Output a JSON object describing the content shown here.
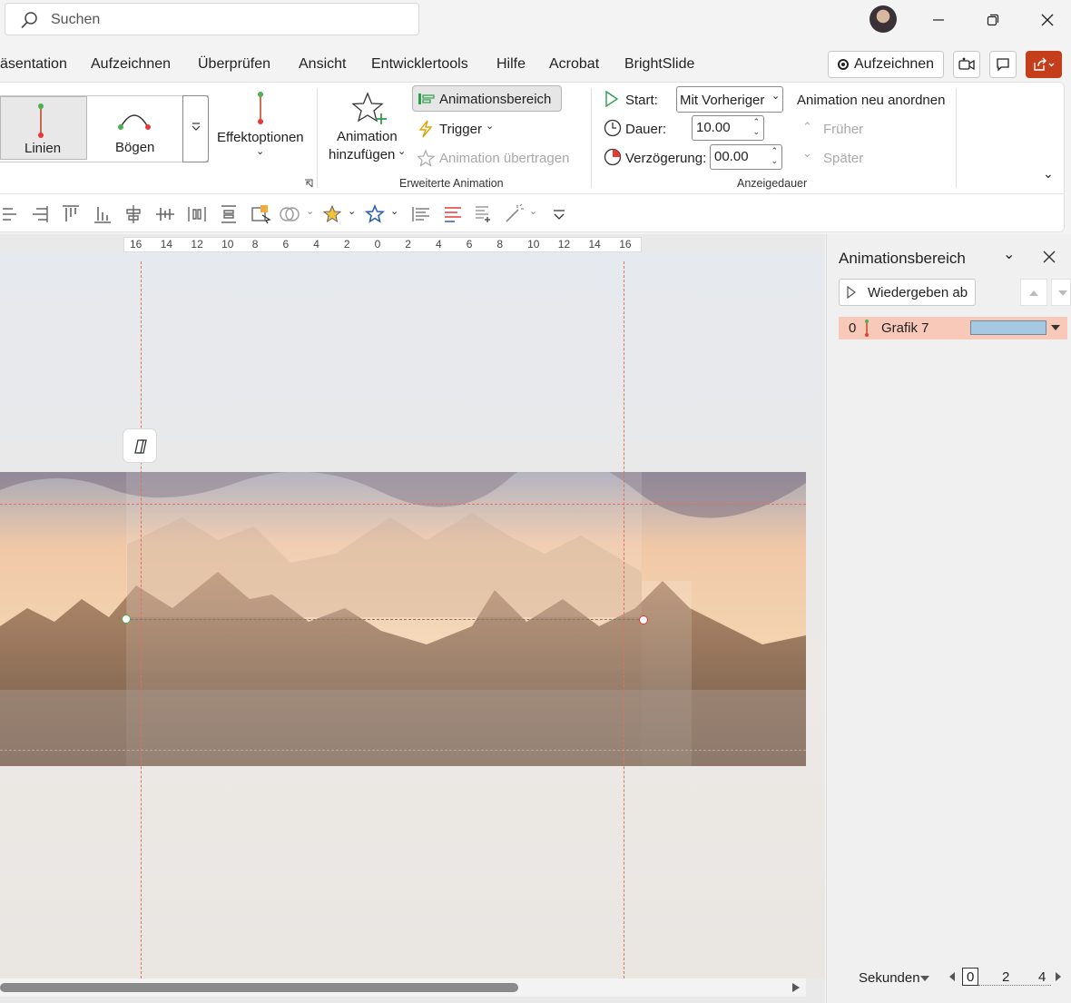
{
  "search": {
    "placeholder": "Suchen"
  },
  "tabs": [
    "äsentation",
    "Aufzeichnen",
    "Überprüfen",
    "Ansicht",
    "Entwicklertools",
    "Hilfe",
    "Acrobat",
    "BrightSlide"
  ],
  "top_buttons": {
    "record": "Aufzeichnen"
  },
  "ribbon": {
    "effects": {
      "lines": "Linien",
      "arcs": "Bögen"
    },
    "effect_options": "Effektoptionen",
    "add_animation": {
      "line1": "Animation",
      "line2": "hinzufügen"
    },
    "animation_pane_btn": "Animationsbereich",
    "trigger": "Trigger",
    "animation_painter": "Animation übertragen",
    "group_advanced": "Erweiterte Animation",
    "start_label": "Start:",
    "start_value": "Mit Vorheriger",
    "duration_label": "Dauer:",
    "duration_value": "10.00",
    "delay_label": "Verzögerung:",
    "delay_value": "00.00",
    "group_timing": "Anzeigedauer",
    "reorder_title": "Animation neu anordnen",
    "earlier": "Früher",
    "later": "Später"
  },
  "ruler_labels": [
    "16",
    "14",
    "12",
    "10",
    "8",
    "6",
    "4",
    "2",
    "0",
    "2",
    "4",
    "6",
    "8",
    "10",
    "12",
    "14",
    "16"
  ],
  "pane": {
    "title": "Animationsbereich",
    "play_from": "Wiedergeben ab",
    "item": {
      "index": "0",
      "name": "Grafik 7",
      "timeline_color": "#a6c8e0"
    },
    "seconds_label": "Sekunden",
    "timeline_ticks": [
      "0",
      "2",
      "4"
    ]
  },
  "colors": {
    "accent_red": "#c43e1c",
    "selected_item_bg": "#f8c8b8",
    "guide_red": "#e07060"
  }
}
